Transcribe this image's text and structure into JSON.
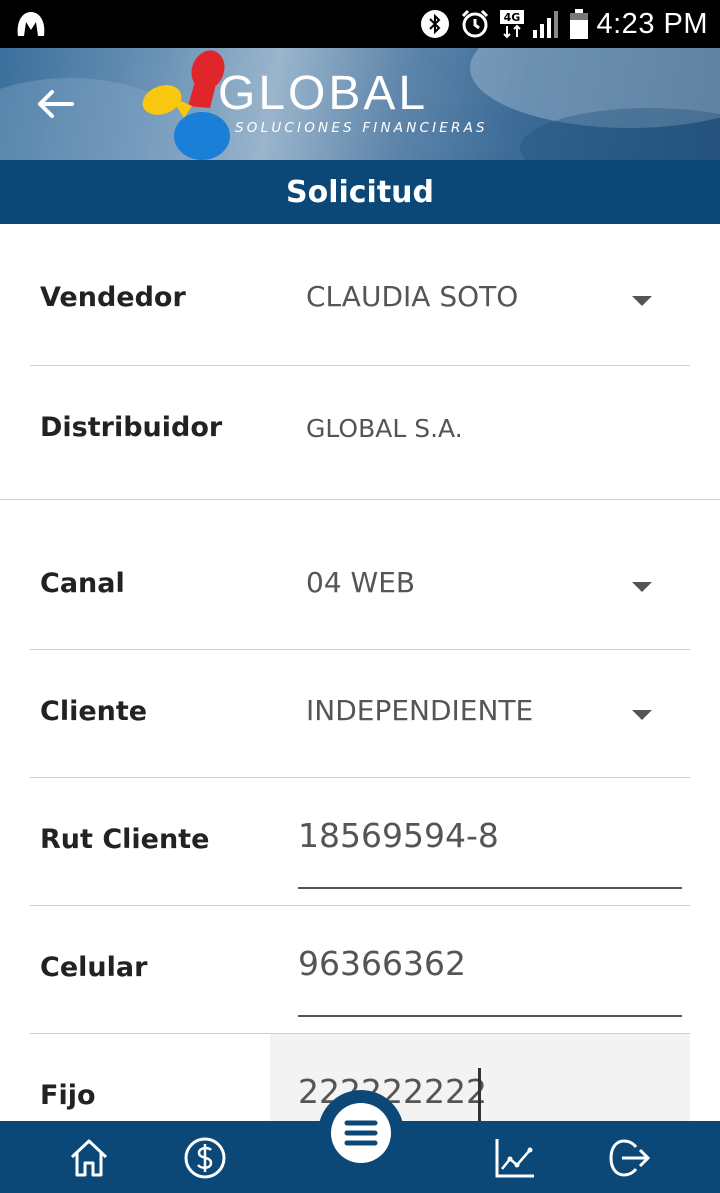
{
  "status_bar": {
    "time": "4:23 PM",
    "network": "4G",
    "icons": [
      "malwarebytes-icon",
      "bluetooth-icon",
      "alarm-icon",
      "network-4g-icon",
      "signal-icon",
      "battery-icon"
    ]
  },
  "header": {
    "brand": "GLOBAL",
    "tagline": "SOLUCIONES FINANCIERAS",
    "back_icon": "arrow-left-icon"
  },
  "title": "Solicitud",
  "form": {
    "vendedor": {
      "label": "Vendedor",
      "value": "CLAUDIA SOTO"
    },
    "distribuidor": {
      "label": "Distribuidor",
      "value": "GLOBAL S.A."
    },
    "canal": {
      "label": "Canal",
      "value": "04 WEB"
    },
    "cliente": {
      "label": "Cliente",
      "value": "INDEPENDIENTE"
    },
    "rut_cliente": {
      "label": "Rut Cliente",
      "value": "18569594-8"
    },
    "celular": {
      "label": "Celular",
      "value": "96366362"
    },
    "fijo": {
      "label": "Fijo",
      "value": "222222222"
    }
  },
  "bottom_nav": {
    "items": [
      "home-icon",
      "dollar-icon",
      "menu-icon",
      "chart-icon",
      "logout-icon"
    ]
  },
  "colors": {
    "primary": "#0b4877",
    "text": "#222222",
    "muted": "#555555",
    "divider": "#cfcfcf"
  }
}
